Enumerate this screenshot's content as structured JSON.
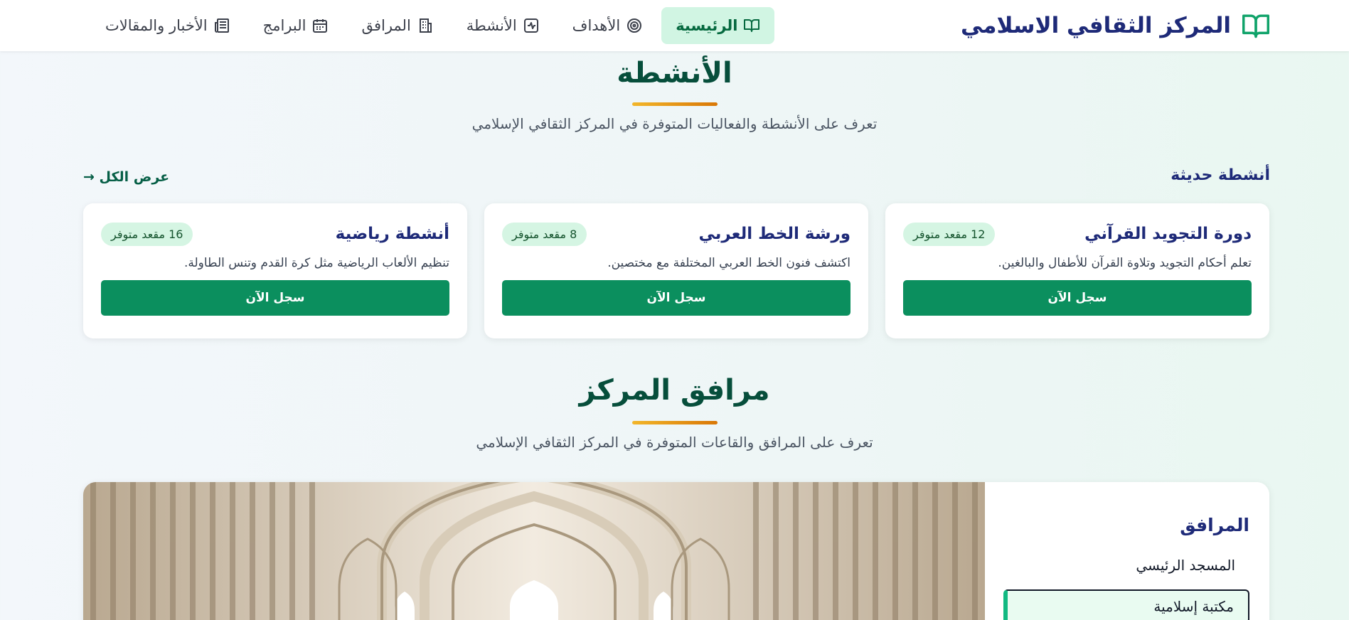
{
  "nav": {
    "brand": "المركز الثقافي الاسلامي",
    "items": [
      {
        "label": "الرئيسية",
        "icon": "book-open-icon",
        "active": true
      },
      {
        "label": "الأهداف",
        "icon": "target-icon"
      },
      {
        "label": "الأنشطة",
        "icon": "activity-icon"
      },
      {
        "label": "المرافق",
        "icon": "building-icon"
      },
      {
        "label": "البرامج",
        "icon": "calendar-icon"
      },
      {
        "label": "الأخبار والمقالات",
        "icon": "newspaper-icon"
      }
    ]
  },
  "activities": {
    "title": "الأنشطة",
    "subtitle": "تعرف على الأنشطة والفعاليات المتوفرة في المركز الثقافي الإسلامي",
    "recent_label": "أنشطة حديثة",
    "view_all": "عرض الكل →",
    "cards": [
      {
        "title": "دورة التجويد القرآني",
        "seats": "12 مقعد متوفر",
        "desc": "تعلم أحكام التجويد وتلاوة القرآن للأطفال والبالغين.",
        "button": "سجل الآن"
      },
      {
        "title": "ورشة الخط العربي",
        "seats": "8 مقعد متوفر",
        "desc": "اكتشف فنون الخط العربي المختلفة مع مختصين.",
        "button": "سجل الآن"
      },
      {
        "title": "أنشطة رياضية",
        "seats": "16 مقعد متوفر",
        "desc": "تنظيم الألعاب الرياضية مثل كرة القدم وتنس الطاولة.",
        "button": "سجل الآن"
      }
    ]
  },
  "facilities": {
    "title": "مرافق المركز",
    "subtitle": "تعرف على المرافق والقاعات المتوفرة في المركز الثقافي الإسلامي",
    "side_title": "المرافق",
    "items": [
      "المسجد الرئيسي",
      "مكتبة إسلامية"
    ]
  },
  "colors": {
    "brand": "#1e2a78",
    "accent_green": "#0b8f5e",
    "active_nav_bg": "#d1f5e3",
    "title_bar": "#f2b62a"
  }
}
